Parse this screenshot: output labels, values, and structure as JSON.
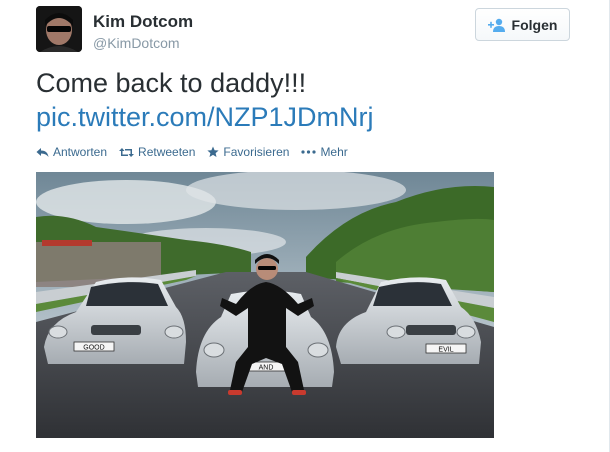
{
  "author": {
    "name": "Kim Dotcom",
    "handle": "@KimDotcom"
  },
  "follow_button": {
    "label": "Folgen"
  },
  "tweet": {
    "text": "Come back to daddy!!!",
    "link": "pic.twitter.com/NZP1JDmNrj"
  },
  "actions": [
    {
      "label": "Antworten",
      "icon": "reply-icon"
    },
    {
      "label": "Retweeten",
      "icon": "retweet-icon"
    },
    {
      "label": "Favorisieren",
      "icon": "star-icon"
    },
    {
      "label": "Mehr",
      "icon": "more-icon"
    }
  ],
  "photo": {
    "plates": [
      "GOOD",
      "AND",
      "EVIL"
    ]
  },
  "colors": {
    "link": "#2b7bb9",
    "action": "#3b6a8f",
    "follow_icon": "#55acee"
  }
}
